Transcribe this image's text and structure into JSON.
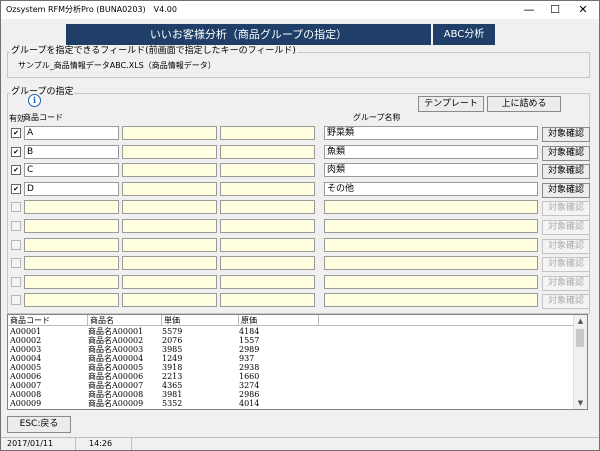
{
  "window": {
    "title": "Ozsystem RFM分析Pro (BUNA0203)　V4.00",
    "minimize": "—",
    "maximize": "☐",
    "close": "✕"
  },
  "header": {
    "title": "いいお客様分析（商品グループの指定）",
    "abc": "ABC分析"
  },
  "field_group": {
    "label": "グループを指定できるフィールド(前画面で指定したキーのフィールド)",
    "text": "サンプル_商品情報データABC.XLS（商品情報データ）"
  },
  "group_section": {
    "label": "グループの指定",
    "template_button": "テンプレート",
    "pack_button": "上に詰める",
    "col_enabled": "有効",
    "col_code": "商品コード",
    "col_name": "グループ名称",
    "confirm_label": "対象確認",
    "rows": [
      {
        "checked": true,
        "code": "A",
        "name": "野菜類",
        "active": true
      },
      {
        "checked": true,
        "code": "B",
        "name": "魚類",
        "active": true
      },
      {
        "checked": true,
        "code": "C",
        "name": "肉類",
        "active": true
      },
      {
        "checked": true,
        "code": "D",
        "name": "その他",
        "active": true
      },
      {
        "checked": false,
        "code": "",
        "name": "",
        "active": false
      },
      {
        "checked": false,
        "code": "",
        "name": "",
        "active": false
      },
      {
        "checked": false,
        "code": "",
        "name": "",
        "active": false
      },
      {
        "checked": false,
        "code": "",
        "name": "",
        "active": false
      },
      {
        "checked": false,
        "code": "",
        "name": "",
        "active": false
      },
      {
        "checked": false,
        "code": "",
        "name": "",
        "active": false
      }
    ]
  },
  "product_list": {
    "columns": [
      "商品コード",
      "商品名",
      "単価",
      "原価"
    ],
    "rows": [
      [
        "A00001",
        "商品名A00001",
        "5579",
        "4184"
      ],
      [
        "A00002",
        "商品名A00002",
        "2076",
        "1557"
      ],
      [
        "A00003",
        "商品名A00003",
        "3985",
        "2989"
      ],
      [
        "A00004",
        "商品名A00004",
        "1249",
        "937"
      ],
      [
        "A00005",
        "商品名A00005",
        "3918",
        "2938"
      ],
      [
        "A00006",
        "商品名A00006",
        "2213",
        "1660"
      ],
      [
        "A00007",
        "商品名A00007",
        "4365",
        "3274"
      ],
      [
        "A00008",
        "商品名A00008",
        "3981",
        "2986"
      ],
      [
        "A00009",
        "商品名A00009",
        "5352",
        "4014"
      ]
    ]
  },
  "footer": {
    "esc_button": "ESC:戻る",
    "date": "2017/01/11",
    "time": "14:26"
  }
}
